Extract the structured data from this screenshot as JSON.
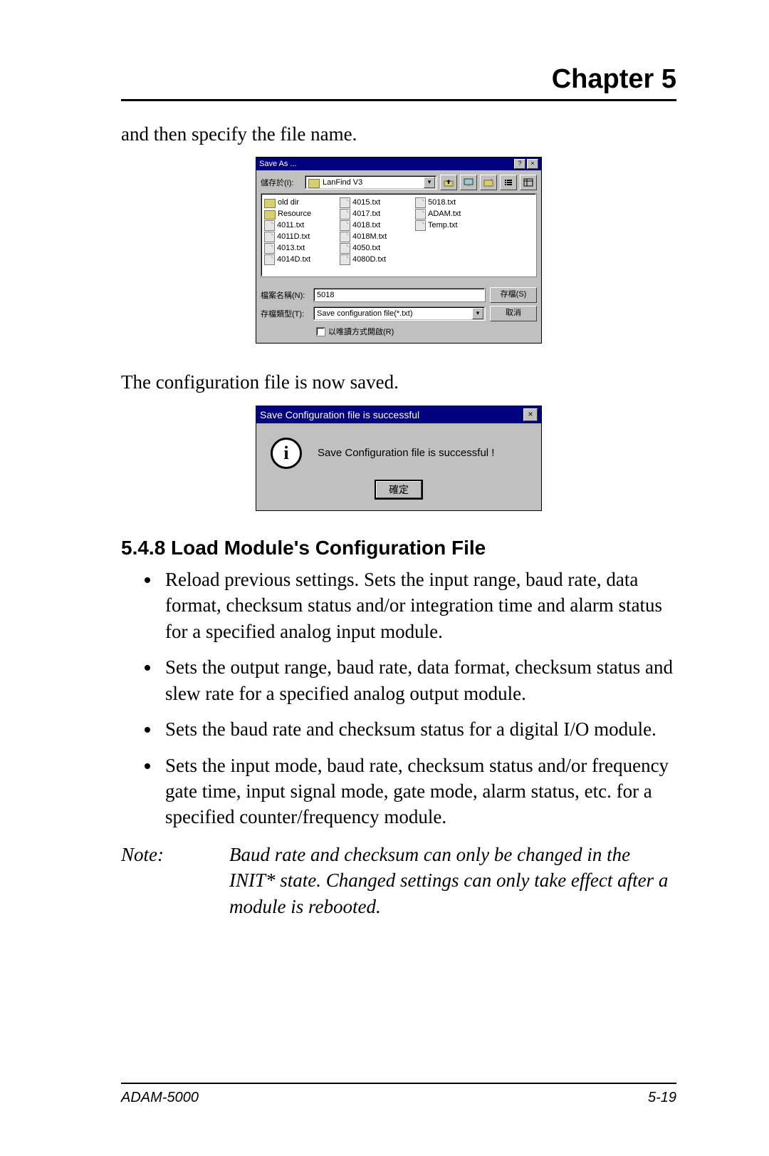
{
  "header": {
    "chapter_label": "Chapter  5"
  },
  "intro_text_1": "and then specify the file name.",
  "saveas_dialog": {
    "title": "Save As ...",
    "location_label": "儲存於(I):",
    "location_value": "LanFind V3",
    "toolbar_icons": [
      "up-icon",
      "desktop-icon",
      "new-folder-icon",
      "list-icon",
      "details-icon"
    ],
    "files": [
      {
        "name": "old dir",
        "type": "folder"
      },
      {
        "name": "Resource",
        "type": "folder"
      },
      {
        "name": "4011.txt",
        "type": "file"
      },
      {
        "name": "4011D.txt",
        "type": "file"
      },
      {
        "name": "4013.txt",
        "type": "file"
      },
      {
        "name": "4014D.txt",
        "type": "file"
      },
      {
        "name": "4015.txt",
        "type": "file"
      },
      {
        "name": "4017.txt",
        "type": "file"
      },
      {
        "name": "4018.txt",
        "type": "file"
      },
      {
        "name": "4018M.txt",
        "type": "file"
      },
      {
        "name": "4050.txt",
        "type": "file"
      },
      {
        "name": "4080D.txt",
        "type": "file"
      },
      {
        "name": "5018.txt",
        "type": "file"
      },
      {
        "name": "ADAM.txt",
        "type": "file"
      },
      {
        "name": "Temp.txt",
        "type": "file"
      }
    ],
    "filename_label": "檔案名稱(N):",
    "filename_value": "5018",
    "filetype_label": "存檔類型(T):",
    "filetype_value": "Save configuration file(*.txt)",
    "save_btn": "存檔(S)",
    "cancel_btn": "取消",
    "readonly_label": "以唯讀方式開啟(R)"
  },
  "intro_text_2": "The configuration file is now saved.",
  "success_dialog": {
    "title": "Save Configuration file is successful",
    "message": "Save Configuration file is successful !",
    "ok_btn": "確定"
  },
  "section": {
    "number": "5.4.8",
    "title": "Load Module's Configuration File",
    "heading_full": "5.4.8   Load Module's Configuration File"
  },
  "bullets": [
    " Reload previous settings. Sets the input range, baud rate, data format, checksum status and/or integration time and alarm status for a specified analog input module.",
    "Sets the output range, baud rate, data format, checksum status and slew rate for a specified analog output module.",
    "Sets the baud rate and checksum status for a digital I/O module.",
    "Sets the input mode, baud rate, checksum status and/or frequency gate time, input signal mode, gate mode, alarm status, etc. for a specified counter/frequency module."
  ],
  "note": {
    "label": "Note:",
    "text": "Baud rate and checksum can only be changed in the INIT* state. Changed settings can only take effect after a module is rebooted."
  },
  "footer": {
    "left": "ADAM-5000",
    "right": "5-19"
  }
}
